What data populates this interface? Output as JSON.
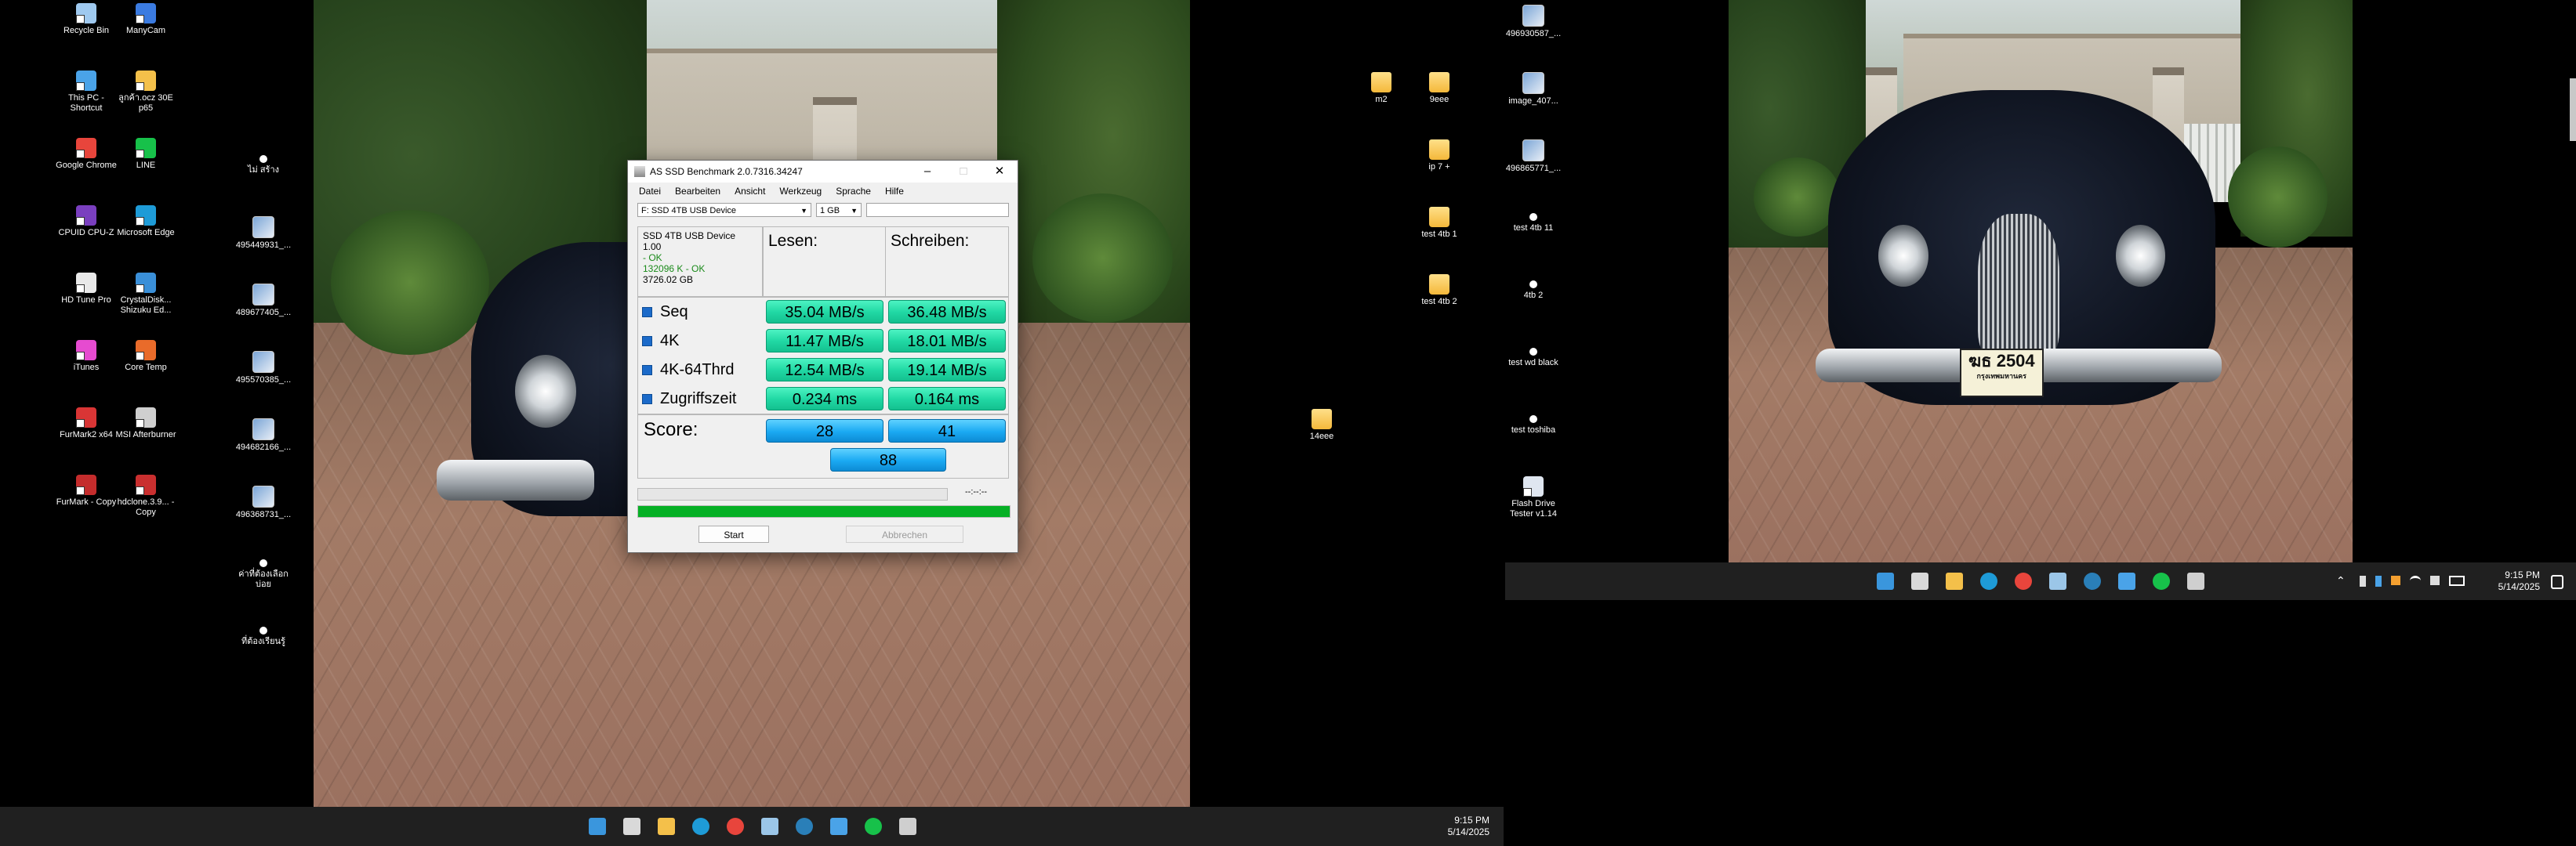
{
  "left_desktop": {
    "icons": [
      {
        "label": "Recycle Bin",
        "color": "#9fc9ef"
      },
      {
        "label": "ManyCam",
        "color": "#3b7be0"
      },
      {
        "label": "This PC - Shortcut",
        "color": "#4aa3e8"
      },
      {
        "label": "ลูกค้า.ocz 30E p65",
        "color": "#f4c04a"
      },
      {
        "label": "Google Chrome",
        "color": "#e8453c"
      },
      {
        "label": "LINE",
        "color": "#17c14a"
      },
      {
        "label": "CPUID CPU-Z",
        "color": "#7a3fbf"
      },
      {
        "label": "Microsoft Edge",
        "color": "#1e9bd7"
      },
      {
        "label": "HD Tune Pro",
        "color": "#e9e9e9"
      },
      {
        "label": "CrystalDisk... Shizuku Ed...",
        "color": "#3a8fd8"
      },
      {
        "label": "iTunes",
        "color": "#e64bd0"
      },
      {
        "label": "Core Temp",
        "color": "#e96b2a"
      },
      {
        "label": "FurMark2 x64",
        "color": "#d93535"
      },
      {
        "label": "MSI Afterburner",
        "color": "#cfcfcf"
      },
      {
        "label": "FurMark - Copy",
        "color": "#c42c2c"
      },
      {
        "label": "hdclone.3.9... - Copy",
        "color": "#c92f2f"
      }
    ],
    "col2": [
      {
        "label": "ไม่ สร้าง"
      },
      {
        "label": "495449931_..."
      },
      {
        "label": "489677405_..."
      },
      {
        "label": "495570385_..."
      },
      {
        "label": "494682166_..."
      },
      {
        "label": "496368731_..."
      },
      {
        "label": "ค่าที่ต้องเลือก บ่อย"
      },
      {
        "label": "ที่ต้องเรียนรู้"
      }
    ],
    "col3": [
      {
        "label": "14eee"
      }
    ]
  },
  "right_desktop": {
    "col1": [
      {
        "label": "m2"
      }
    ],
    "col2": [
      {
        "label": "9eee"
      },
      {
        "label": "ip 7 +"
      },
      {
        "label": "test 4tb 1"
      },
      {
        "label": "test 4tb 2"
      }
    ],
    "col3": [
      {
        "label": "496930587_..."
      },
      {
        "label": "image_407..."
      },
      {
        "label": "496865771_..."
      },
      {
        "label": "test 4tb 11"
      },
      {
        "label": "4tb 2"
      },
      {
        "label": "test wd black"
      },
      {
        "label": "test toshiba"
      },
      {
        "label": "Flash Drive Tester v1.14"
      }
    ]
  },
  "right_photo": {
    "plate_text": "ฆธ 2504",
    "plate_sub": "กรุงเทพมหานคร"
  },
  "taskbar": {
    "icons": [
      "start",
      "task-view",
      "file-explorer",
      "edge",
      "chrome",
      "task-manager",
      "edge-dev",
      "notepad",
      "line",
      "as-ssd"
    ],
    "time": "9:15 PM",
    "date": "5/14/2025"
  },
  "window": {
    "title": "AS SSD Benchmark 2.0.7316.34247",
    "menu": [
      "Datei",
      "Bearbeiten",
      "Ansicht",
      "Werkzeug",
      "Sprache",
      "Hilfe"
    ],
    "drive_select": "F: SSD 4TB USB Device",
    "size_select": "1 GB",
    "device": {
      "name": "SSD 4TB USB Device",
      "version": "1.00",
      "status1": "- OK",
      "status2": "132096 K - OK",
      "capacity": "3726.02 GB"
    },
    "read_header": "Lesen:",
    "write_header": "Schreiben:",
    "rows": [
      {
        "label": "Seq",
        "read": "35.04 MB/s",
        "write": "36.48 MB/s"
      },
      {
        "label": "4K",
        "read": "11.47 MB/s",
        "write": "18.01 MB/s"
      },
      {
        "label": "4K-64Thrd",
        "read": "12.54 MB/s",
        "write": "19.14 MB/s"
      },
      {
        "label": "Zugriffszeit",
        "read": "0.234 ms",
        "write": "0.164 ms"
      }
    ],
    "score_label": "Score:",
    "score_read": "28",
    "score_write": "41",
    "score_total": "88",
    "progress_time": "--:--:--",
    "progress_fraction": 1.0,
    "start_button": "Start",
    "cancel_button": "Abbrechen"
  }
}
